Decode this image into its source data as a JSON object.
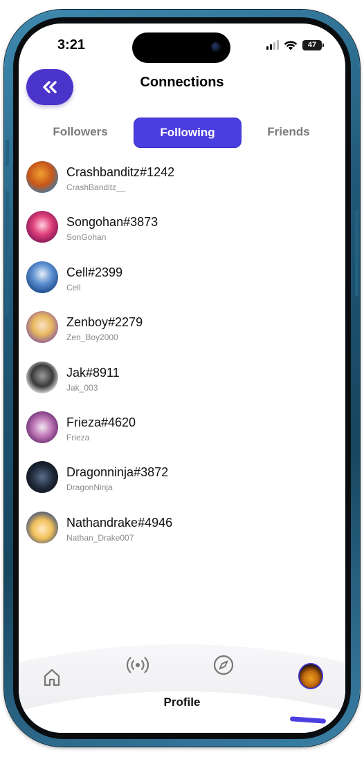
{
  "status_bar": {
    "time": "3:21",
    "battery": "47"
  },
  "header": {
    "title": "Connections",
    "back_icon": "double-chevron-left-icon"
  },
  "tabs": [
    {
      "label": "Followers",
      "active": false
    },
    {
      "label": "Following",
      "active": true
    },
    {
      "label": "Friends",
      "active": false
    }
  ],
  "users": [
    {
      "name": "Crashbanditz#1242",
      "handle": "CrashBanditz__"
    },
    {
      "name": "Songohan#3873",
      "handle": "SonGohan"
    },
    {
      "name": "Cell#2399",
      "handle": "Cell"
    },
    {
      "name": "Zenboy#2279",
      "handle": "Zen_Boy2000"
    },
    {
      "name": "Jak#8911",
      "handle": "Jak_003"
    },
    {
      "name": "Frieza#4620",
      "handle": "Frieza"
    },
    {
      "name": "Dragonninja#3872",
      "handle": "DragonNinja"
    },
    {
      "name": "Nathandrake#4946",
      "handle": "Nathan_Drake007"
    }
  ],
  "bottom_nav": {
    "items": [
      "home-icon",
      "radar-icon",
      "compass-icon",
      "profile-avatar"
    ],
    "active_label": "Profile"
  },
  "colors": {
    "accent": "#4b3ee0",
    "back_button": "#4b34c9",
    "frame": "#1f5878"
  }
}
